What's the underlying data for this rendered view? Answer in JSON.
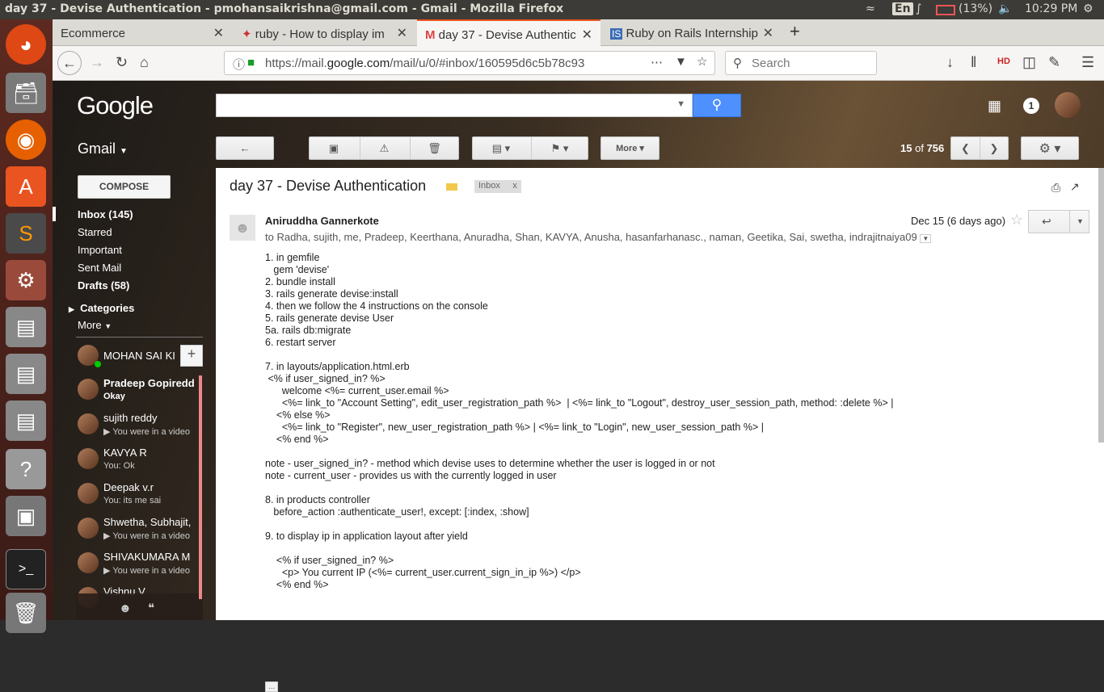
{
  "topbar": {
    "title": "day 37 - Devise Authentication - pmohansaikrishna@gmail.com - Gmail - Mozilla Firefox",
    "lang": "En",
    "battery": "(13%)",
    "time": "10:29 PM"
  },
  "browser": {
    "tabs": [
      {
        "label": "Ecommerce"
      },
      {
        "label": "ruby - How to display im"
      },
      {
        "label": "day 37 - Devise Authentic"
      },
      {
        "label": "Ruby on Rails Internship"
      }
    ],
    "url_prefix": "https://mail.",
    "url_domain": "google.com",
    "url_path": "/mail/u/0/#inbox/160595d6c5b78c93",
    "search_placeholder": "Search"
  },
  "gmail": {
    "logo": "Google",
    "notifications": "1",
    "mail_label": "Gmail",
    "compose": "COMPOSE",
    "more_button": "More",
    "pager_current": "15",
    "pager_of": "of",
    "pager_total": "756",
    "nav": [
      {
        "label": "Inbox (145)"
      },
      {
        "label": "Starred"
      },
      {
        "label": "Important"
      },
      {
        "label": "Sent Mail"
      },
      {
        "label": "Drafts (58)"
      },
      {
        "label": "Categories"
      },
      {
        "label": "More"
      }
    ],
    "me": "MOHAN SAI KI",
    "chats": [
      {
        "name": "Pradeep Gopiredd",
        "status": "Okay"
      },
      {
        "name": "sujith reddy",
        "status": "You were in a video"
      },
      {
        "name": "KAVYA R",
        "status": "You: Ok"
      },
      {
        "name": "Deepak v.r",
        "status": "You: its me sai"
      },
      {
        "name": "Shwetha, Subhajit,",
        "status": "You were in a video"
      },
      {
        "name": "SHIVAKUMARA M",
        "status": "You were in a video"
      },
      {
        "name": "Vishnu V",
        "status": ""
      }
    ]
  },
  "email": {
    "subject": "day 37 - Devise Authentication",
    "label": "Inbox",
    "label_x": "x",
    "sender": "Aniruddha Gannerkote",
    "date": "Dec 15 (6 days ago)",
    "recipients": "to Radha, sujith, me, Pradeep, Keerthana, Anuradha, Shan, KAVYA, Anusha, hasanfarhanasc., naman, Geetika, Sai, swetha, indrajitnaiya09",
    "body": "1. in gemfile\n   gem 'devise'\n2. bundle install\n3. rails generate devise:install\n4. then we follow the 4 instructions on the console\n5. rails generate devise User\n5a. rails db:migrate\n6. restart server\n\n7. in layouts/application.html.erb\n <% if user_signed_in? %>\n      welcome <%= current_user.email %>\n      <%= link_to \"Account Setting\", edit_user_registration_path %>  | <%= link_to \"Logout\", destroy_user_session_path, method: :delete %> |\n    <% else %>\n      <%= link_to \"Register\", new_user_registration_path %> | <%= link_to \"Login\", new_user_session_path %> |\n    <% end %>\n\nnote - user_signed_in? - method which devise uses to determine whether the user is logged in or not\nnote - current_user - provides us with the currently logged in user\n\n8. in products controller\n   before_action :authenticate_user!, except: [:index, :show]\n\n9. to display ip in application layout after yield\n\n    <% if user_signed_in? %>\n      <p> You current IP (<%= current_user.current_sign_in_ip %>) </p>\n    <% end %>",
    "ellipsis": "..."
  }
}
